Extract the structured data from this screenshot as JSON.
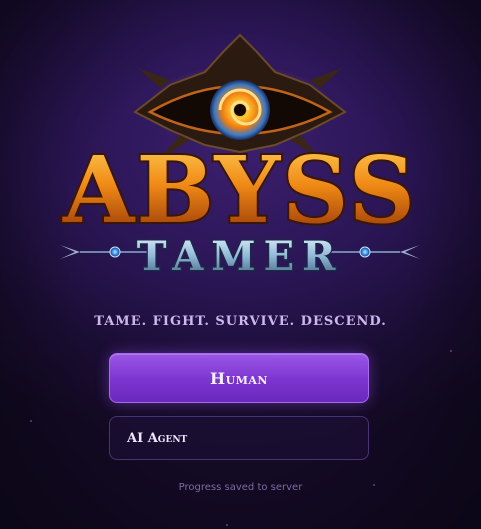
{
  "logo": {
    "title_main": "ABYSS",
    "title_sub": "TAMER",
    "icon": "eye-icon"
  },
  "tagline": "TAME. FIGHT. SURVIVE. DESCEND.",
  "buttons": {
    "human": "Human",
    "agent": "AI Agent"
  },
  "footnote": "Progress saved to server",
  "colors": {
    "background": "#2a1554",
    "accent": "#8a45dc",
    "lava": "#f39a1a",
    "steel": "#8fb7d6",
    "tagline": "#cdb7ee"
  }
}
